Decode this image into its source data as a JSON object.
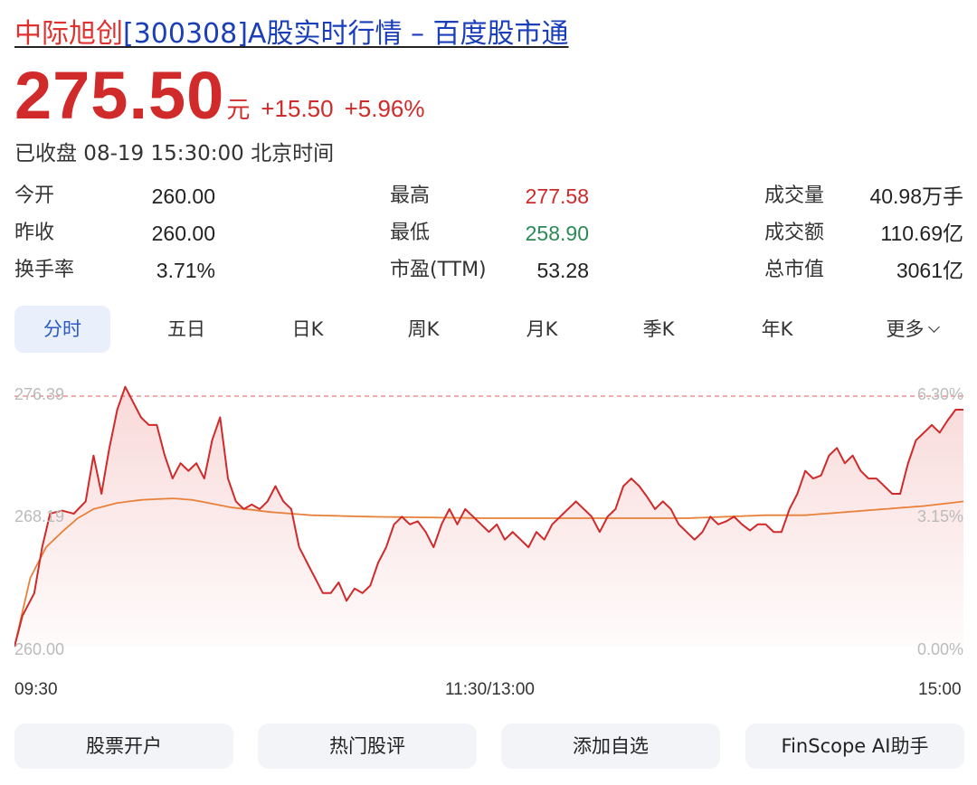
{
  "header": {
    "title_name": "中际旭创",
    "title_rest": "[300308]A股实时行情 – 百度股市通"
  },
  "quote": {
    "price": "275.50",
    "unit": "元",
    "change": "+15.50",
    "change_pct": "+5.96%",
    "status": "已收盘 08-19 15:30:00 北京时间"
  },
  "stats": [
    {
      "label": "今开",
      "value": "260.00"
    },
    {
      "label": "昨收",
      "value": "260.00"
    },
    {
      "label": "换手率",
      "value": "3.71%"
    },
    {
      "label": "最高",
      "value": "277.58"
    },
    {
      "label": "最低",
      "value": "258.90"
    },
    {
      "label": "市盈(TTM)",
      "value": "53.28"
    },
    {
      "label": "成交量",
      "value": "40.98万手"
    },
    {
      "label": "成交额",
      "value": "110.69亿"
    },
    {
      "label": "总市值",
      "value": "3061亿"
    }
  ],
  "tabs": [
    "分时",
    "五日",
    "日K",
    "周K",
    "月K",
    "季K",
    "年K",
    "更多"
  ],
  "colors": {
    "up": "#d02a2a",
    "down": "#2b8a57",
    "avg_line": "#e8813a",
    "accent": "#2b59c9"
  },
  "chart_data": {
    "type": "line",
    "y_left_ticks": [
      "276.39",
      "268.19",
      "260.00"
    ],
    "y_right_ticks": [
      "6.30%",
      "3.15%",
      "0.00%"
    ],
    "x_ticks": [
      "09:30",
      "11:30/13:00",
      "15:00"
    ],
    "ylim": [
      260.0,
      276.39
    ],
    "x_count": 241,
    "series": [
      {
        "role": "price",
        "keypoints": [
          [
            0,
            260.0
          ],
          [
            2,
            262.0
          ],
          [
            5,
            263.5
          ],
          [
            7,
            266.5
          ],
          [
            9,
            268.7
          ],
          [
            12,
            268.9
          ],
          [
            15,
            268.7
          ],
          [
            18,
            269.5
          ],
          [
            20,
            272.5
          ],
          [
            22,
            270.0
          ],
          [
            24,
            273.0
          ],
          [
            26,
            275.5
          ],
          [
            28,
            277.0
          ],
          [
            30,
            276.0
          ],
          [
            32,
            275.0
          ],
          [
            34,
            274.5
          ],
          [
            36,
            274.5
          ],
          [
            38,
            272.5
          ],
          [
            40,
            271.0
          ],
          [
            42,
            272.0
          ],
          [
            44,
            271.5
          ],
          [
            46,
            272.0
          ],
          [
            48,
            271.0
          ],
          [
            50,
            273.5
          ],
          [
            52,
            275.0
          ],
          [
            54,
            271.0
          ],
          [
            56,
            269.5
          ],
          [
            58,
            269.0
          ],
          [
            60,
            269.3
          ],
          [
            62,
            269.0
          ],
          [
            64,
            269.5
          ],
          [
            66,
            270.5
          ],
          [
            68,
            269.5
          ],
          [
            70,
            269.0
          ],
          [
            72,
            266.5
          ],
          [
            74,
            265.5
          ],
          [
            76,
            264.5
          ],
          [
            78,
            263.5
          ],
          [
            80,
            263.5
          ],
          [
            82,
            264.2
          ],
          [
            84,
            263.0
          ],
          [
            86,
            263.8
          ],
          [
            88,
            263.5
          ],
          [
            90,
            264.0
          ],
          [
            92,
            265.5
          ],
          [
            94,
            266.5
          ],
          [
            96,
            268.0
          ],
          [
            98,
            268.5
          ],
          [
            100,
            268.0
          ],
          [
            102,
            268.2
          ],
          [
            104,
            267.5
          ],
          [
            106,
            266.5
          ],
          [
            108,
            268.0
          ],
          [
            110,
            269.0
          ],
          [
            112,
            268.0
          ],
          [
            114,
            269.0
          ],
          [
            116,
            268.5
          ],
          [
            118,
            268.0
          ],
          [
            120,
            267.5
          ],
          [
            122,
            268.0
          ],
          [
            124,
            267.0
          ],
          [
            126,
            267.5
          ],
          [
            128,
            267.0
          ],
          [
            130,
            266.5
          ],
          [
            132,
            267.5
          ],
          [
            134,
            267.0
          ],
          [
            136,
            268.0
          ],
          [
            138,
            268.5
          ],
          [
            140,
            269.0
          ],
          [
            142,
            269.5
          ],
          [
            144,
            269.0
          ],
          [
            146,
            268.5
          ],
          [
            148,
            267.5
          ],
          [
            150,
            268.5
          ],
          [
            152,
            269.0
          ],
          [
            154,
            270.5
          ],
          [
            156,
            271.0
          ],
          [
            158,
            270.5
          ],
          [
            160,
            269.8
          ],
          [
            162,
            269.0
          ],
          [
            164,
            269.5
          ],
          [
            166,
            269.0
          ],
          [
            168,
            268.0
          ],
          [
            170,
            267.5
          ],
          [
            172,
            267.0
          ],
          [
            174,
            267.5
          ],
          [
            176,
            268.5
          ],
          [
            178,
            268.0
          ],
          [
            180,
            268.2
          ],
          [
            182,
            268.5
          ],
          [
            184,
            268.0
          ],
          [
            186,
            267.6
          ],
          [
            188,
            268.0
          ],
          [
            190,
            268.0
          ],
          [
            192,
            267.5
          ],
          [
            194,
            267.5
          ],
          [
            196,
            269.0
          ],
          [
            198,
            270.0
          ],
          [
            200,
            271.5
          ],
          [
            202,
            271.0
          ],
          [
            204,
            271.2
          ],
          [
            206,
            272.5
          ],
          [
            208,
            273.0
          ],
          [
            210,
            272.0
          ],
          [
            212,
            272.5
          ],
          [
            214,
            271.5
          ],
          [
            216,
            271.0
          ],
          [
            218,
            271.0
          ],
          [
            220,
            270.5
          ],
          [
            222,
            270.0
          ],
          [
            224,
            270.0
          ],
          [
            226,
            272.0
          ],
          [
            228,
            273.5
          ],
          [
            230,
            274.0
          ],
          [
            232,
            274.5
          ],
          [
            234,
            274.0
          ],
          [
            236,
            274.8
          ],
          [
            238,
            275.5
          ],
          [
            240,
            275.5
          ]
        ]
      },
      {
        "role": "average",
        "keypoints": [
          [
            0,
            260.0
          ],
          [
            4,
            264.5
          ],
          [
            8,
            266.5
          ],
          [
            12,
            267.5
          ],
          [
            16,
            268.4
          ],
          [
            20,
            269.0
          ],
          [
            26,
            269.4
          ],
          [
            32,
            269.6
          ],
          [
            40,
            269.7
          ],
          [
            45,
            269.6
          ],
          [
            55,
            269.1
          ],
          [
            65,
            268.8
          ],
          [
            75,
            268.6
          ],
          [
            90,
            268.5
          ],
          [
            120,
            268.4
          ],
          [
            150,
            268.4
          ],
          [
            170,
            268.4
          ],
          [
            180,
            268.5
          ],
          [
            190,
            268.6
          ],
          [
            200,
            268.6
          ],
          [
            210,
            268.8
          ],
          [
            220,
            269.0
          ],
          [
            230,
            269.2
          ],
          [
            240,
            269.5
          ]
        ]
      }
    ]
  },
  "actions": [
    "股票开户",
    "热门股评",
    "添加自选",
    "FinScope AI助手"
  ]
}
